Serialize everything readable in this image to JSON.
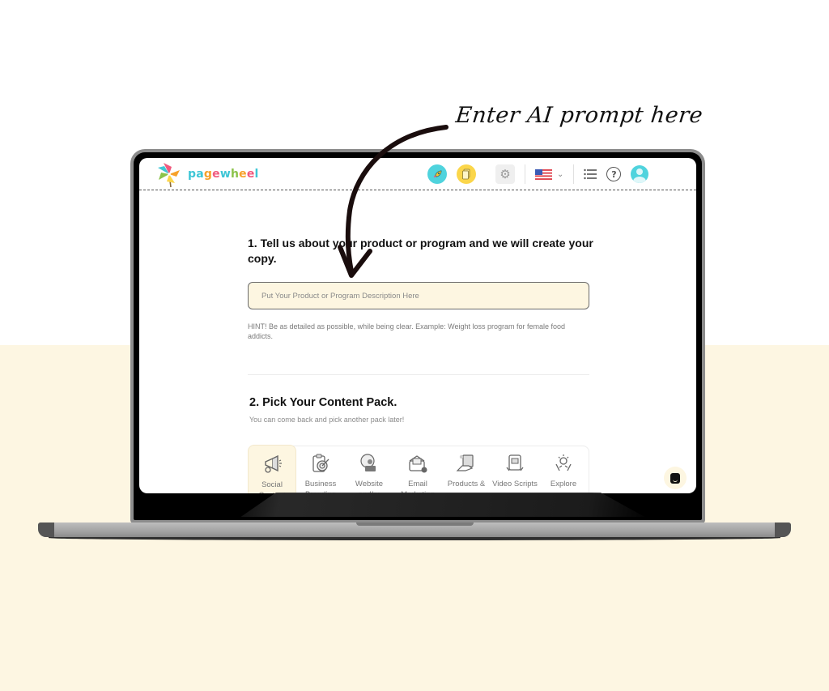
{
  "annotation": {
    "text": "Enter AI prompt here"
  },
  "app": {
    "logo_text": [
      "p",
      "a",
      "g",
      "e",
      "w",
      "h",
      "e",
      "e",
      "l"
    ],
    "brand": "pagewheel",
    "header_icons": {
      "rocket": "rocket-icon",
      "document": "document-icon",
      "settings": "gear-icon",
      "language": "us-flag-icon",
      "language_chevron": "chevron-down-icon",
      "list": "list-icon",
      "help": "question-icon",
      "profile": "user-avatar-icon"
    },
    "help_glyph": "?",
    "chevron_glyph": "⌄",
    "list_glyph": "☰",
    "gear_glyph": "⚙",
    "rocket_glyph": "🚀",
    "doc_glyph": "📄"
  },
  "step1": {
    "heading": "1. Tell us about your product or program and we will create your copy.",
    "input_placeholder": "Put Your Product or Program Description Here",
    "input_value": "",
    "hint": "HINT! Be as detailed as possible, while being clear. Example: Weight loss program for female food addicts."
  },
  "step2": {
    "heading": "2. Pick Your Content Pack.",
    "subheading": "You can come back and pick another pack later!",
    "packs": [
      {
        "label": "Social Content",
        "icon": "megaphone-icon",
        "glyph": "📢",
        "active": true
      },
      {
        "label": "Business Branding",
        "icon": "target-clipboard-icon",
        "glyph": "🎯",
        "active": false
      },
      {
        "label": "Website and/or",
        "icon": "web-user-icon",
        "glyph": "🌐",
        "active": false
      },
      {
        "label": "Email Marketing",
        "icon": "email-icon",
        "glyph": "✉",
        "active": false
      },
      {
        "label": "Products &",
        "icon": "product-hand-icon",
        "glyph": "🛍",
        "active": false
      },
      {
        "label": "Video Scripts",
        "icon": "video-icon",
        "glyph": "📹",
        "active": false
      },
      {
        "label": "Explore",
        "icon": "lightbulb-hands-icon",
        "glyph": "💡",
        "active": false
      }
    ]
  },
  "chat": {
    "icon": "chat-icon"
  },
  "colors": {
    "cream": "#fdf6e1",
    "teal": "#4fd3dd",
    "yellow": "#fbd64a"
  }
}
